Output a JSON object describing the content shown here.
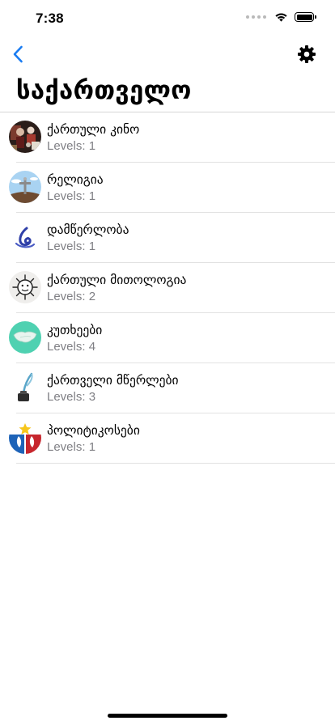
{
  "status_bar": {
    "time": "7:38"
  },
  "nav": {
    "back_icon": "chevron-left-icon",
    "settings_icon": "gear-icon",
    "accent_color": "#1a7cf2"
  },
  "page": {
    "title": "საქართველო"
  },
  "items": [
    {
      "title": "ქართული კინო",
      "subtitle": "Levels: 1",
      "icon": "cinema-poster-icon"
    },
    {
      "title": "რელიგია",
      "subtitle": "Levels: 1",
      "icon": "cross-icon"
    },
    {
      "title": "დამწერლობა",
      "subtitle": "Levels: 1",
      "icon": "script-letter-icon"
    },
    {
      "title": "ქართული მითოლოგია",
      "subtitle": "Levels: 2",
      "icon": "sun-face-icon"
    },
    {
      "title": "კუთხეები",
      "subtitle": "Levels: 4",
      "icon": "map-region-icon"
    },
    {
      "title": "ქართველი მწერლები",
      "subtitle": "Levels: 3",
      "icon": "quill-inkwell-icon"
    },
    {
      "title": "პოლიტიკოსები",
      "subtitle": "Levels: 1",
      "icon": "political-parties-icon"
    }
  ]
}
